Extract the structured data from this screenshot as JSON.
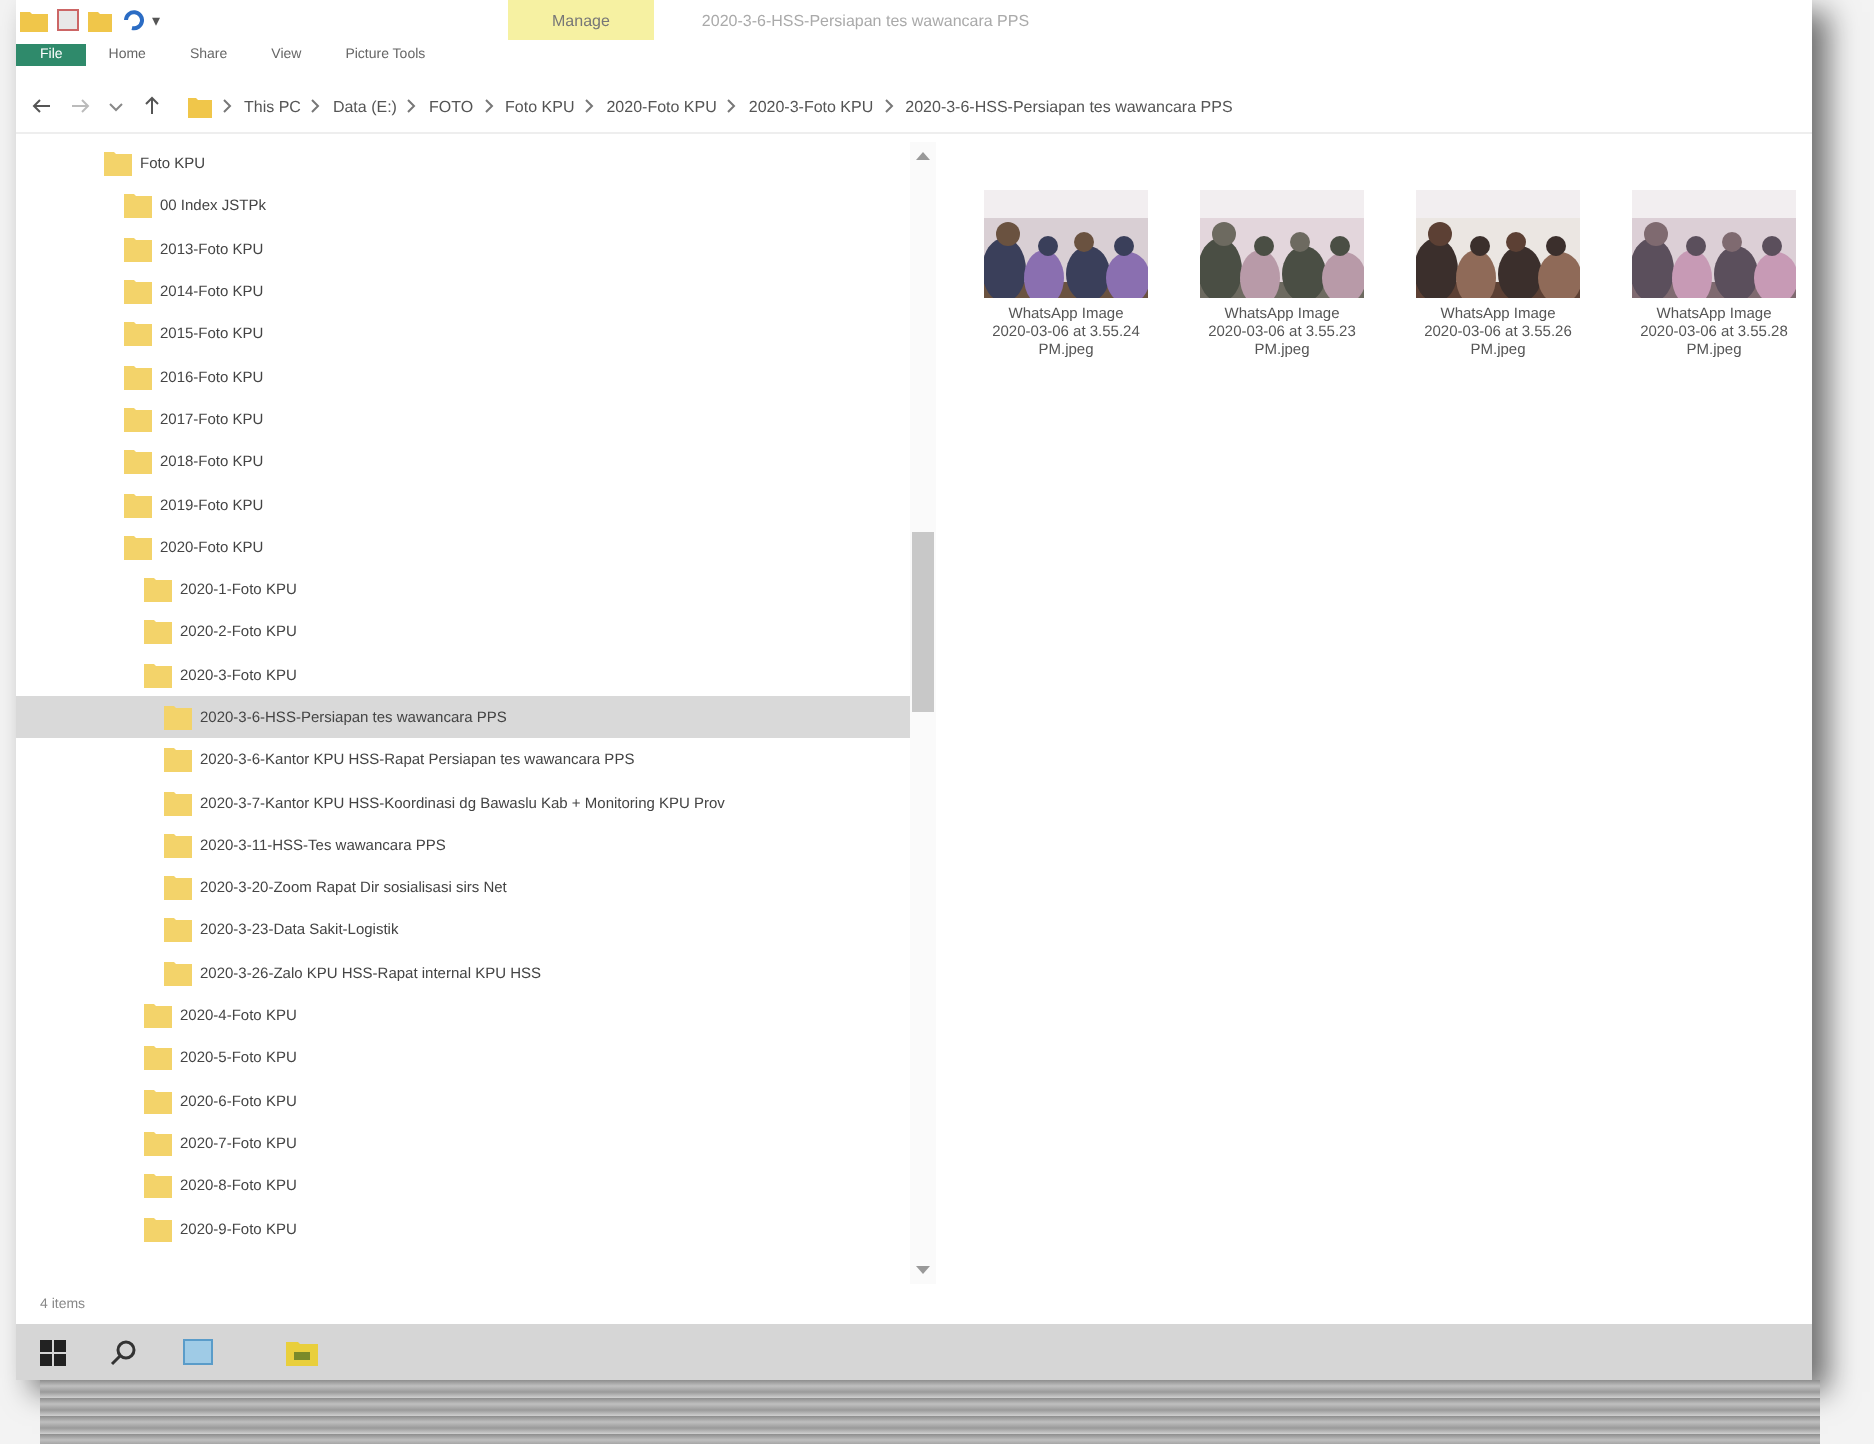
{
  "quick_access": {
    "pin": "▾"
  },
  "ribbon": {
    "context_tab": "Manage",
    "window_title": "2020-3-6-HSS-Persiapan tes wawancara PPS",
    "tabs": [
      {
        "label": "File",
        "selected": true
      },
      {
        "label": "Home",
        "selected": false
      },
      {
        "label": "Share",
        "selected": false
      },
      {
        "label": "View",
        "selected": false
      },
      {
        "label": "Picture Tools",
        "selected": false
      }
    ]
  },
  "address_bar": {
    "path": [
      "This PC",
      "Data (E:)",
      "FOTO",
      "Foto KPU",
      "2020-Foto KPU",
      "2020-3-Foto KPU",
      "2020-3-6-HSS-Persiapan tes wawancara PPS"
    ]
  },
  "navigation_tree": [
    {
      "label": "Foto KPU",
      "selected": false,
      "children": [
        {
          "label": "00 Index JSTPk",
          "selected": false
        },
        {
          "label": "2013-Foto KPU",
          "selected": false
        },
        {
          "label": "2014-Foto KPU",
          "selected": false
        },
        {
          "label": "2015-Foto KPU",
          "selected": false
        },
        {
          "label": "2016-Foto KPU",
          "selected": false
        },
        {
          "label": "2017-Foto KPU",
          "selected": false
        },
        {
          "label": "2018-Foto KPU",
          "selected": false
        },
        {
          "label": "2019-Foto KPU",
          "selected": false
        },
        {
          "label": "2020-Foto KPU",
          "selected": false,
          "children": [
            {
              "label": "2020-1-Foto KPU",
              "selected": false
            },
            {
              "label": "2020-2-Foto KPU",
              "selected": false
            },
            {
              "label": "2020-3-Foto KPU",
              "selected": false,
              "children": [
                {
                  "label": "2020-3-6-HSS-Persiapan tes wawancara PPS",
                  "selected": true
                },
                {
                  "label": "2020-3-6-Kantor KPU HSS-Rapat Persiapan tes wawancara PPS",
                  "selected": false
                },
                {
                  "label": "2020-3-7-Kantor KPU HSS-Koordinasi dg Bawaslu Kab + Monitoring KPU Prov",
                  "selected": false
                },
                {
                  "label": "2020-3-11-HSS-Tes wawancara PPS",
                  "selected": false
                },
                {
                  "label": "2020-3-20-Zoom Rapat Dir sosialisasi sirs Net",
                  "selected": false
                },
                {
                  "label": "2020-3-23-Data Sakit-Logistik",
                  "selected": false
                },
                {
                  "label": "2020-3-26-Zalo KPU HSS-Rapat internal KPU HSS",
                  "selected": false
                }
              ]
            },
            {
              "label": "2020-4-Foto KPU",
              "selected": false
            },
            {
              "label": "2020-5-Foto KPU",
              "selected": false
            },
            {
              "label": "2020-6-Foto KPU",
              "selected": false
            },
            {
              "label": "2020-7-Foto KPU",
              "selected": false
            },
            {
              "label": "2020-8-Foto KPU",
              "selected": false
            },
            {
              "label": "2020-9-Foto KPU",
              "selected": false
            }
          ]
        }
      ]
    }
  ],
  "files": [
    {
      "name": "WhatsApp Image 2020-03-06 at 3.55.24 PM.jpeg",
      "kind": "picture"
    },
    {
      "name": "WhatsApp Image 2020-03-06 at 3.55.23 PM.jpeg",
      "kind": "picture"
    },
    {
      "name": "WhatsApp Image 2020-03-06 at 3.55.26 PM.jpeg",
      "kind": "picture"
    },
    {
      "name": "WhatsApp Image 2020-03-06 at 3.55.28 PM.jpeg",
      "kind": "picture"
    }
  ],
  "status_bar": {
    "item_count": "4 items"
  }
}
